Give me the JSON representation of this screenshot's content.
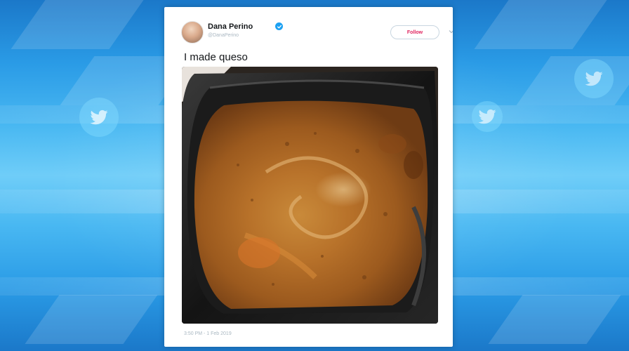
{
  "background": {
    "primary_color": "#2a9be6",
    "highlight_color": "#6fcdf8",
    "icon": "twitter-bird-icon"
  },
  "tweet": {
    "author": {
      "display_name": "Dana Perino",
      "handle": "@DanaPerino",
      "verified": true,
      "avatar_icon": "avatar"
    },
    "follow_label": "Follow",
    "follow_color": "#e0245e",
    "menu_icon": "chevron-down-icon",
    "text": "I made queso",
    "media": {
      "description_icon": "queso-photo"
    },
    "timestamp": "3:50 PM - 1 Feb 2019"
  }
}
